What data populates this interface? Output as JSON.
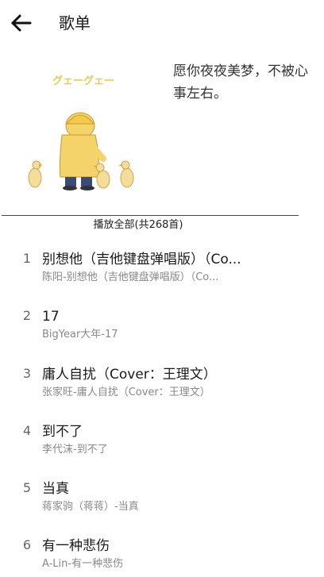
{
  "header": {
    "back_icon": "arrow-left-icon",
    "title": "歌单"
  },
  "playlist": {
    "cover_caption": "グェーグェー",
    "description": "愿你夜夜美梦，不被心事左右。",
    "play_all_label": "播放全部(共268首)"
  },
  "songs": [
    {
      "index": "1",
      "name": "别想他（吉他键盘弹唱版）（Co...",
      "sub": "陈阳-别想他（吉他键盘弹唱版）（Co..."
    },
    {
      "index": "2",
      "name": "17",
      "sub": "BigYear大年-17"
    },
    {
      "index": "3",
      "name": "庸人自扰（Cover：王理文）",
      "sub": "张家旺-庸人自扰（Cover：王理文）"
    },
    {
      "index": "4",
      "name": "到不了",
      "sub": "李代沫-到不了"
    },
    {
      "index": "5",
      "name": "当真",
      "sub": "蒋家驹（蒋蒋）-当真"
    },
    {
      "index": "6",
      "name": "有一种悲伤",
      "sub": "A-Lin-有一种悲伤"
    }
  ]
}
